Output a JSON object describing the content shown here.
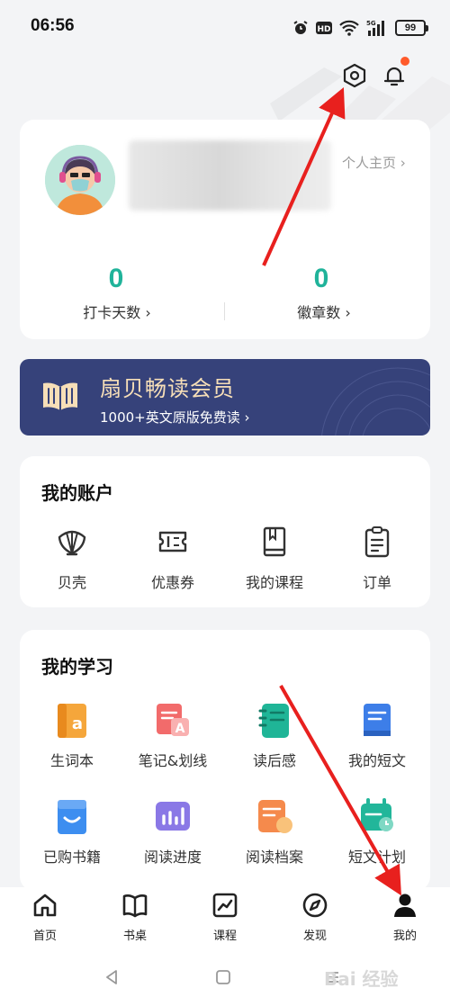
{
  "status_bar": {
    "time": "06:56",
    "battery": "99"
  },
  "profile": {
    "home_link": "个人主页 ›",
    "checkin_count": "0",
    "checkin_label": "打卡天数 ›",
    "badge_count": "0",
    "badge_label": "徽章数 ›"
  },
  "membership": {
    "title": "扇贝畅读会员",
    "subtitle": "1000+英文原版免费读 ›"
  },
  "account": {
    "title": "我的账户",
    "items": [
      {
        "label": "贝壳",
        "icon": "shell-icon"
      },
      {
        "label": "优惠券",
        "icon": "coupon-icon"
      },
      {
        "label": "我的课程",
        "icon": "course-book-icon"
      },
      {
        "label": "订单",
        "icon": "order-clipboard-icon"
      }
    ]
  },
  "study": {
    "title": "我的学习",
    "items": [
      {
        "label": "生词本",
        "icon": "vocabulary-book-icon"
      },
      {
        "label": "笔记&划线",
        "icon": "notes-icon"
      },
      {
        "label": "读后感",
        "icon": "reading-reflection-icon"
      },
      {
        "label": "我的短文",
        "icon": "my-essay-icon"
      },
      {
        "label": "已购书籍",
        "icon": "purchased-books-icon"
      },
      {
        "label": "阅读进度",
        "icon": "reading-progress-icon"
      },
      {
        "label": "阅读档案",
        "icon": "reading-archive-icon"
      },
      {
        "label": "短文计划",
        "icon": "essay-plan-icon"
      }
    ]
  },
  "bottom_nav": {
    "items": [
      {
        "label": "首页",
        "icon": "home-icon"
      },
      {
        "label": "书桌",
        "icon": "book-icon"
      },
      {
        "label": "课程",
        "icon": "chart-icon"
      },
      {
        "label": "发现",
        "icon": "compass-icon"
      },
      {
        "label": "我的",
        "icon": "person-icon"
      }
    ],
    "active": "我的"
  },
  "watermark": "Bai 经验",
  "colors": {
    "accent": "#20b39a",
    "member_bg": "#36427a",
    "member_title": "#f7dfb8",
    "annotation_arrow": "#e8201e",
    "notification_dot": "#ff5a2b"
  }
}
